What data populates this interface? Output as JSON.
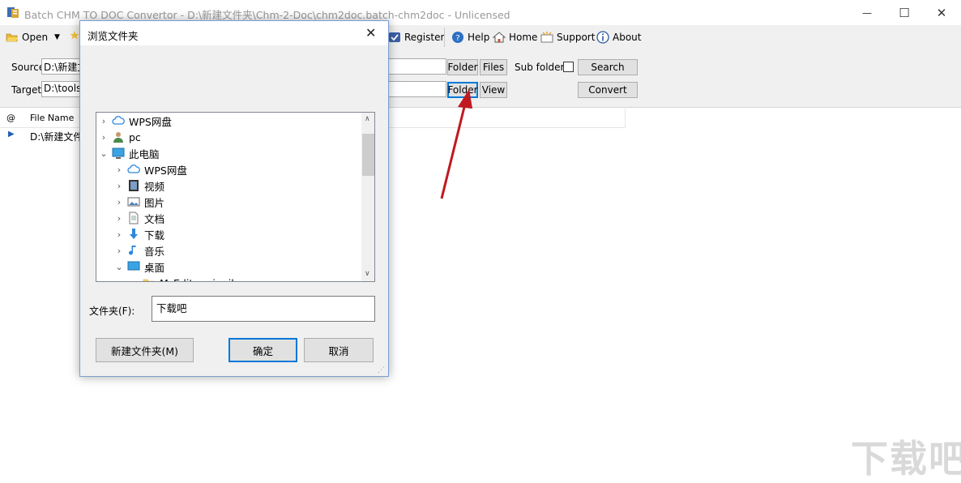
{
  "window": {
    "title": "Batch CHM TO DOC Convertor - D:\\新建文件夹\\Chm-2-Doc\\chm2doc.batch-chm2doc - Unlicensed",
    "minimize": "—",
    "maximize": "☐",
    "close": "✕"
  },
  "toolbar": {
    "open": "Open",
    "register": "Register",
    "help": "Help",
    "home": "Home",
    "support": "Support",
    "about": "About"
  },
  "options": {
    "source_label": "Source",
    "source_value": "D:\\新建文",
    "target_label": "Target",
    "target_value": "D:\\tools\\",
    "folder_btn": "Folder",
    "files_btn": "Files",
    "subfolders_label": "Sub folders",
    "search_btn": "Search",
    "folder_btn2": "Folder",
    "view_btn": "View",
    "convert_btn": "Convert"
  },
  "list": {
    "col_at": "@",
    "col_filename": "File Name",
    "row1": "D:\\新建文件"
  },
  "dialog": {
    "title": "浏览文件夹",
    "close": "✕",
    "tree": [
      {
        "label": "WPS网盘",
        "indent": 0,
        "caret": "›",
        "icon": "cloud-icon"
      },
      {
        "label": "pc",
        "indent": 0,
        "caret": "›",
        "icon": "user-icon"
      },
      {
        "label": "此电脑",
        "indent": 0,
        "caret": "⌄",
        "icon": "computer-icon"
      },
      {
        "label": "WPS网盘",
        "indent": 1,
        "caret": "›",
        "icon": "cloud-icon"
      },
      {
        "label": "视频",
        "indent": 1,
        "caret": "›",
        "icon": "video-icon"
      },
      {
        "label": "图片",
        "indent": 1,
        "caret": "›",
        "icon": "picture-icon"
      },
      {
        "label": "文档",
        "indent": 1,
        "caret": "›",
        "icon": "document-icon"
      },
      {
        "label": "下载",
        "indent": 1,
        "caret": "›",
        "icon": "download-icon"
      },
      {
        "label": "音乐",
        "indent": 1,
        "caret": "›",
        "icon": "music-icon"
      },
      {
        "label": "桌面",
        "indent": 1,
        "caret": "⌄",
        "icon": "desktop-icon"
      },
      {
        "label": "M_Editor_ringil",
        "indent": 2,
        "caret": "›",
        "icon": "folder-icon"
      }
    ],
    "folder_label": "文件夹(F):",
    "folder_value": "下载吧",
    "new_folder_btn": "新建文件夹(M)",
    "ok_btn": "确定",
    "cancel_btn": "取消"
  },
  "watermark": "下载吧"
}
